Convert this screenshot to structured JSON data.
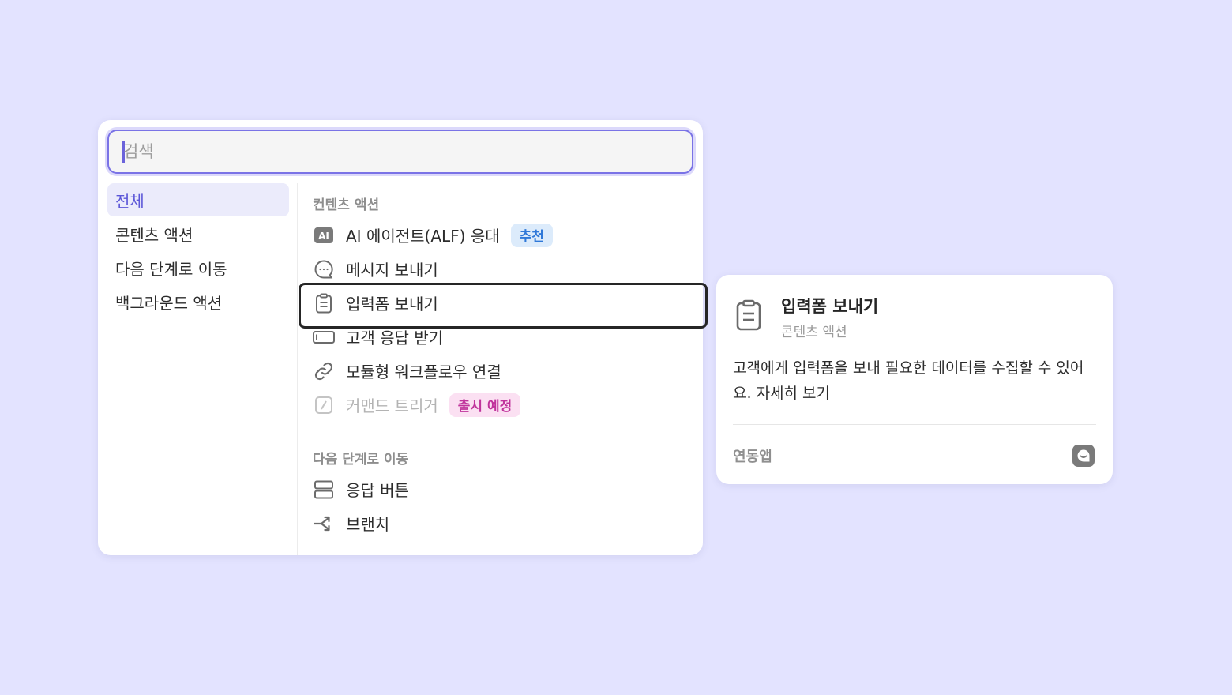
{
  "search": {
    "placeholder": "검색",
    "value": ""
  },
  "sidebar": {
    "items": [
      {
        "label": "전체",
        "active": true
      },
      {
        "label": "콘텐츠 액션"
      },
      {
        "label": "다음 단계로 이동"
      },
      {
        "label": "백그라운드 액션"
      }
    ]
  },
  "content": {
    "sections": [
      {
        "header": "컨텐츠 액션",
        "rows": [
          {
            "label": "AI 에이전트(ALF) 응대",
            "icon": "ai-icon",
            "badge": "추천"
          },
          {
            "label": "메시지 보내기",
            "icon": "chat-bubble-icon"
          },
          {
            "label": "입력폼 보내기",
            "icon": "clipboard-icon",
            "selected": true
          },
          {
            "label": "고객 응답 받기",
            "icon": "input-box-icon"
          },
          {
            "label": "모듈형 워크플로우 연결",
            "icon": "link-icon"
          },
          {
            "label": "커맨드 트리거",
            "icon": "slash-command-icon",
            "badge": "출시 예정",
            "disabled": true
          }
        ]
      },
      {
        "header": "다음 단계로 이동",
        "rows": [
          {
            "label": "응답 버튼",
            "icon": "button-stack-icon"
          },
          {
            "label": "브랜치",
            "icon": "branch-icon"
          }
        ]
      }
    ]
  },
  "detail": {
    "title": "입력폼 보내기",
    "subtitle": "콘텐츠 액션",
    "description": "고객에게 입력폼을 보내 필요한 데이터를 수집할 수 있어요.",
    "more_link": "자세히 보기",
    "footer_label": "연동앱",
    "footer_icon": "channel-app-icon"
  },
  "colors": {
    "background": "#e3e3ff",
    "accent": "#5c57d8",
    "badge_recommend": "#2f78d8",
    "badge_upcoming": "#c0339c"
  }
}
